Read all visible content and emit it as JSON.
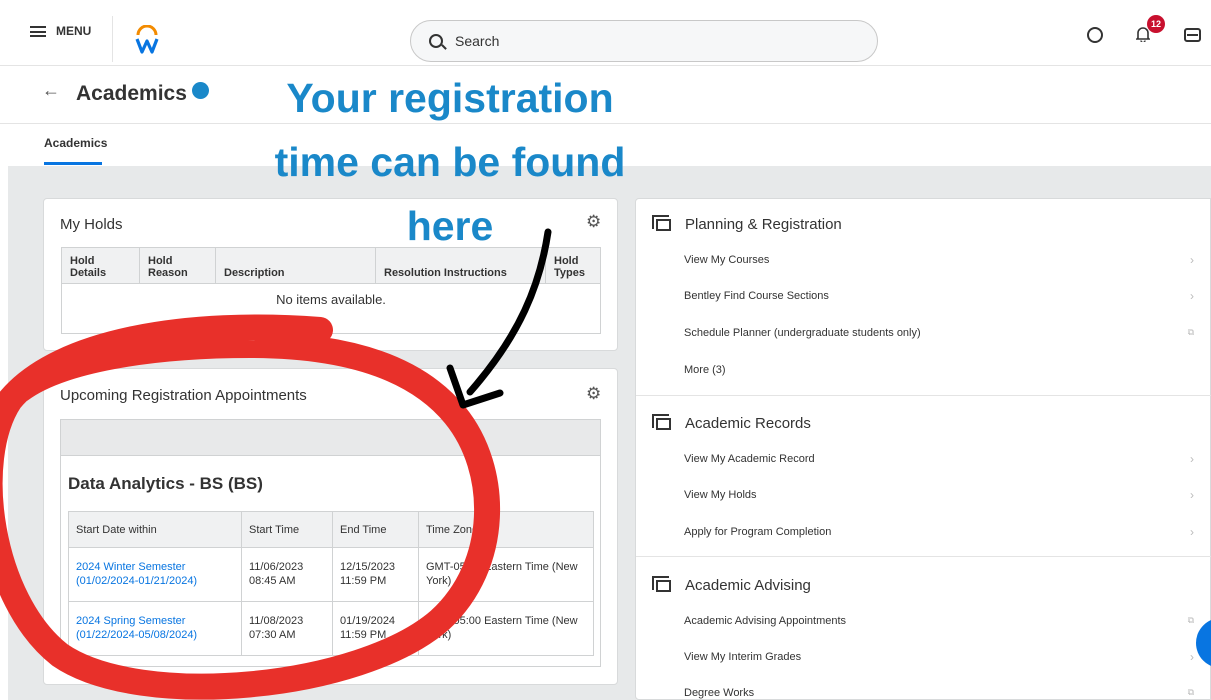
{
  "topbar": {
    "menu_label": "MENU",
    "search_placeholder": "Search",
    "notification_count": "12"
  },
  "header": {
    "back_label": "←",
    "title": "Academics"
  },
  "tabs": [
    {
      "label": "Academics"
    }
  ],
  "my_holds": {
    "title": "My Holds",
    "columns": [
      "Hold Details",
      "Hold Reason",
      "Description",
      "Resolution Instructions",
      "Hold Types"
    ],
    "empty_text": "No items available."
  },
  "appointments": {
    "title": "Upcoming Registration Appointments",
    "program": "Data Analytics - BS (BS)",
    "columns": [
      "Start Date within",
      "Start Time",
      "End Time",
      "Time Zone"
    ],
    "rows": [
      {
        "start_date_within": "2024 Winter Semester (01/02/2024-01/21/2024)",
        "start_time": "11/06/2023 08:45 AM",
        "end_time": "12/15/2023 11:59 PM",
        "time_zone": "GMT-05:00 Eastern Time (New York)"
      },
      {
        "start_date_within": "2024 Spring Semester (01/22/2024-05/08/2024)",
        "start_time": "11/08/2023 07:30 AM",
        "end_time": "01/19/2024 11:59 PM",
        "time_zone": "GMT-05:00 Eastern Time (New York)"
      }
    ]
  },
  "right_panel": {
    "planning": {
      "title": "Planning & Registration",
      "items": [
        "View My Courses",
        "Bentley Find Course Sections",
        "Schedule Planner (undergraduate students only)",
        "More (3)"
      ]
    },
    "records": {
      "title": "Academic Records",
      "items": [
        "View My Academic Record",
        "View My Holds",
        "Apply for Program Completion"
      ]
    },
    "advising": {
      "title": "Academic Advising",
      "items": [
        "Academic Advising Appointments",
        "View My Interim Grades",
        "Degree Works"
      ]
    }
  },
  "annotation": {
    "line1": "Your registration",
    "line2": "time can be found",
    "line3": "here",
    "color": "#1a88c9",
    "circle_color": "#e8302a"
  },
  "colors": {
    "link": "#0875e1",
    "badge": "#c8102e"
  }
}
